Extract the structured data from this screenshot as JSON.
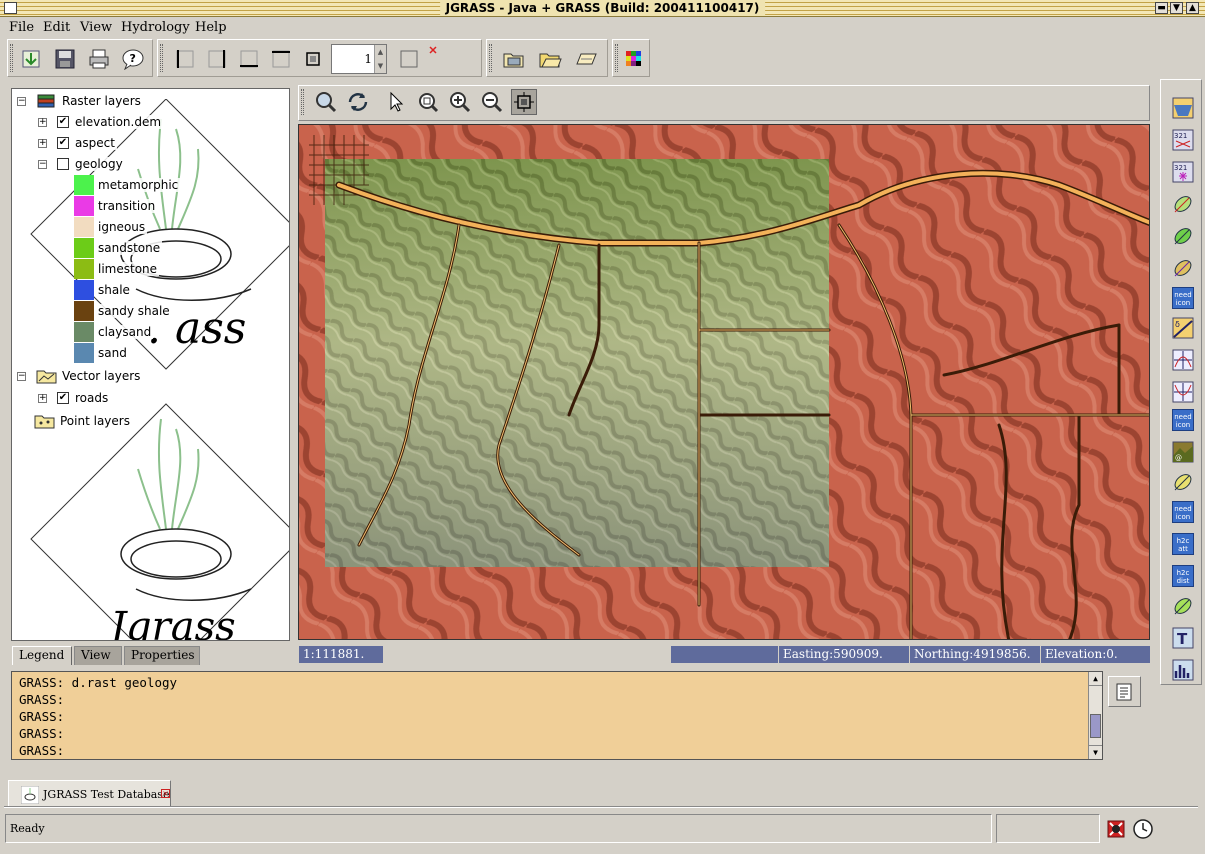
{
  "window": {
    "title": "JGRASS - Java + GRASS  (Build: 200411100417)"
  },
  "menubar": {
    "items": [
      "File",
      "Edit",
      "View",
      "Hydrology",
      "Help"
    ]
  },
  "toolbar": {
    "zoom_value": "1"
  },
  "layers_tree": {
    "raster_root": "Raster layers",
    "raster_layers": [
      {
        "name": "elevation.dem",
        "checked": true
      },
      {
        "name": "aspect",
        "checked": true
      },
      {
        "name": "geology",
        "checked": false
      }
    ],
    "geology_legend": [
      {
        "label": "metamorphic",
        "color": "#4cf24c"
      },
      {
        "label": "transition",
        "color": "#ea3ae6"
      },
      {
        "label": "igneous",
        "color": "#f2dcc0"
      },
      {
        "label": "sandstone",
        "color": "#6ccc18"
      },
      {
        "label": "limestone",
        "color": "#8cbc14"
      },
      {
        "label": "shale",
        "color": "#2e4fe0"
      },
      {
        "label": "sandy shale",
        "color": "#6a4210"
      },
      {
        "label": "claysand",
        "color": "#6a8a66"
      },
      {
        "label": "sand",
        "color": "#5a88b0"
      }
    ],
    "vector_root": "Vector layers",
    "vector_layers": [
      {
        "name": "roads",
        "checked": true
      }
    ],
    "point_root": "Point layers",
    "watermark_text": "Jgrass",
    "watermark_text_partial": ". ass"
  },
  "left_tabs": [
    "Legend",
    "View",
    "Properties"
  ],
  "map_status": {
    "scale": "1:111881.",
    "easting": "Easting:590909.",
    "northing": "Northing:4919856.",
    "elevation": "Elevation:0."
  },
  "console": {
    "lines": [
      "GRASS: d.rast geology",
      "GRASS:",
      "GRASS:",
      "GRASS:",
      "GRASS:"
    ]
  },
  "right_strip": {
    "need_icon_text": "need icon",
    "h2c_att": "h2c att",
    "h2c_dist": "h2c dist"
  },
  "database_tab": {
    "label": "JGRASS Test Database"
  },
  "status": {
    "text": "Ready"
  },
  "colors": {
    "console_bg": "#f0cf98",
    "status_cell": "#5f6b9c",
    "titlebar": "#c2a246"
  }
}
